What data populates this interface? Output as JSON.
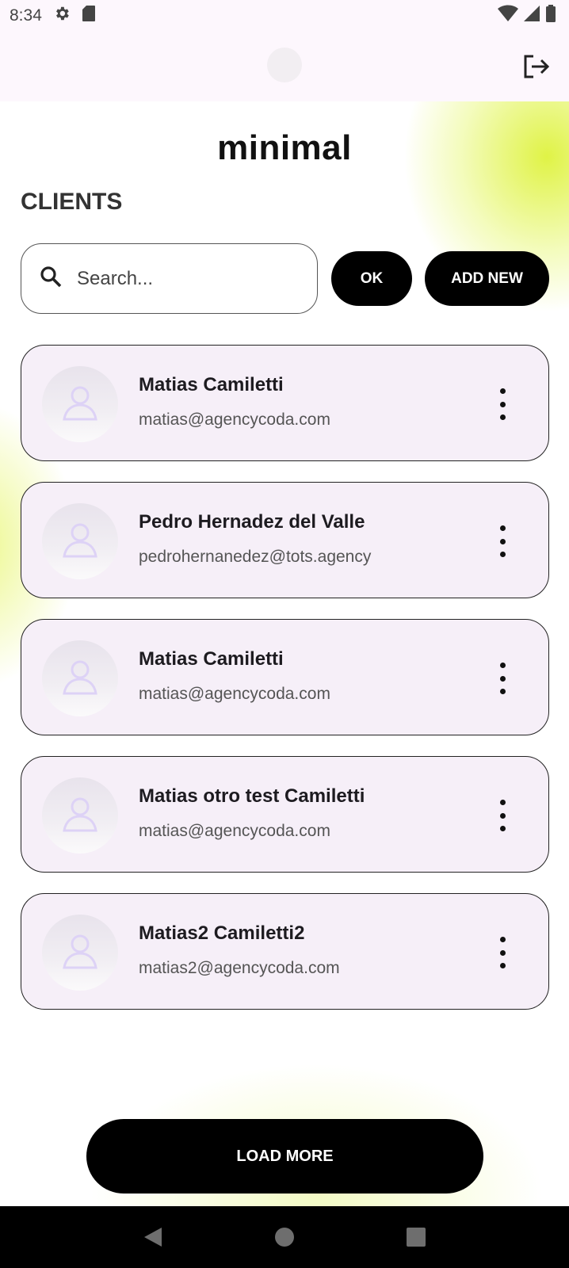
{
  "status_bar": {
    "time": "8:34"
  },
  "app": {
    "brand": "minimal",
    "section_title": "CLIENTS"
  },
  "search": {
    "placeholder": "Search...",
    "ok_label": "OK",
    "add_new_label": "ADD NEW"
  },
  "clients": [
    {
      "name": "Matias Camiletti",
      "email": "matias@agencycoda.com"
    },
    {
      "name": "Pedro Hernadez del Valle",
      "email": "pedrohernanedez@tots.agency"
    },
    {
      "name": "Matias Camiletti",
      "email": "matias@agencycoda.com"
    },
    {
      "name": "Matias otro test Camiletti",
      "email": "matias@agencycoda.com"
    },
    {
      "name": "Matias2 Camiletti2",
      "email": "matias2@agencycoda.com"
    }
  ],
  "load_more_label": "LOAD MORE",
  "colors": {
    "accent": "#000000",
    "card_background": "#f6eff8",
    "highlight": "#def23c"
  },
  "icons": {
    "status": [
      "settings-icon",
      "sd-card-icon",
      "wifi-icon",
      "signal-icon",
      "battery-icon"
    ],
    "app_bar": "logout-icon",
    "search": "search-icon",
    "card_menu": "more-vert-icon",
    "nav": [
      "back-icon",
      "home-icon",
      "recents-icon"
    ]
  }
}
